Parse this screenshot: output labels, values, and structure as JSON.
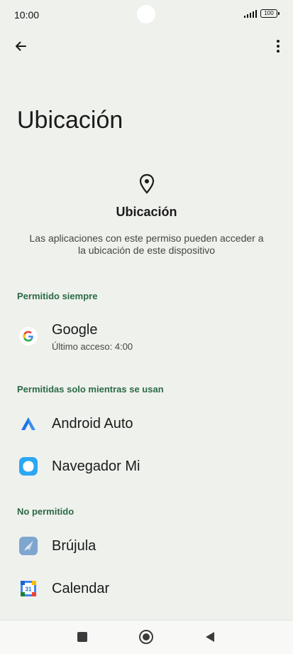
{
  "status": {
    "time": "10:00",
    "battery": "100"
  },
  "page": {
    "title": "Ubicación"
  },
  "hero": {
    "title": "Ubicación",
    "description": "Las aplicaciones con este permiso pueden acceder a la ubicación de este dispositivo"
  },
  "sections": {
    "always": "Permitido siempre",
    "while_using": "Permitidas solo mientras se usan",
    "denied": "No permitido"
  },
  "apps": {
    "google": {
      "name": "Google",
      "sub": "Último acceso: 4:00",
      "icon": "google-icon"
    },
    "android_auto": {
      "name": "Android Auto",
      "icon": "android-auto-icon"
    },
    "navegador": {
      "name": "Navegador Mi",
      "icon": "mi-browser-icon"
    },
    "brujula": {
      "name": "Brújula",
      "icon": "compass-icon"
    },
    "calendar": {
      "name": "Calendar",
      "icon": "calendar-icon",
      "day": "31"
    }
  },
  "colors": {
    "background": "#eff1ed",
    "section_header": "#2b6a46"
  }
}
